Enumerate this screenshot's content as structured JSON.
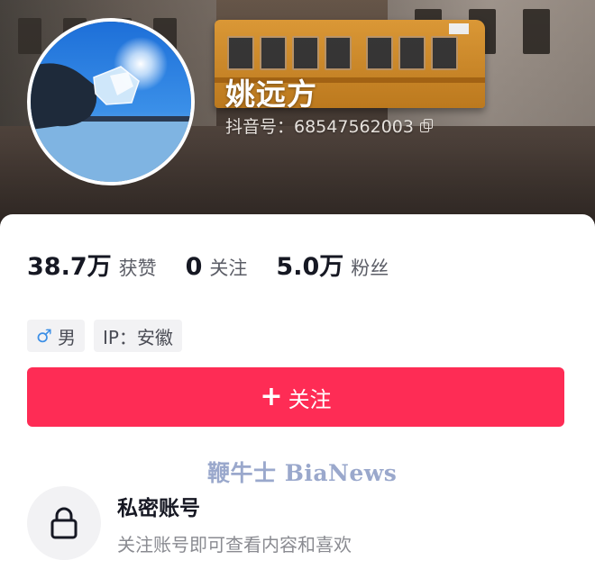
{
  "profile": {
    "username": "姚远方",
    "douyin_id": "抖音号：68547562003",
    "avatar_icon": "avatar-image"
  },
  "stats": [
    {
      "value": "38.7万",
      "label": "获赞"
    },
    {
      "value": "0",
      "label": "关注"
    },
    {
      "value": "5.0万",
      "label": "粉丝"
    }
  ],
  "tags": {
    "gender_symbol": "♂",
    "gender": "男",
    "ip": "IP：安徽"
  },
  "follow_button": {
    "icon": "+",
    "label": "关注",
    "color": "#fe2c55"
  },
  "watermark": "鞭牛士 BiaNews",
  "private_account": {
    "title": "私密账号",
    "description": "关注账号即可查看内容和喜欢",
    "icon": "lock-icon"
  }
}
